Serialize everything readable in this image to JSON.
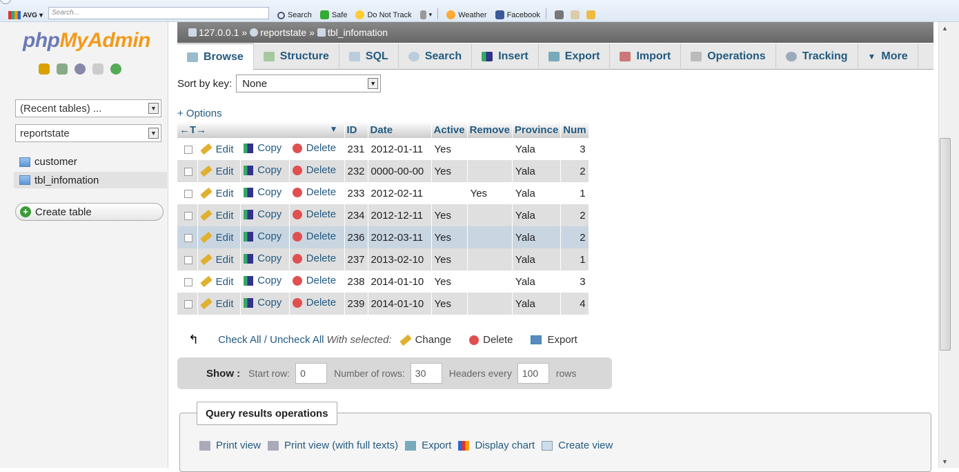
{
  "toolbar": {
    "brand": "AVG",
    "brand_dropdown": "▾",
    "search_placeholder": "Search...",
    "items": [
      "Search",
      "Safe",
      "Do Not Track",
      "Weather",
      "Facebook"
    ]
  },
  "nav": {
    "logo_part1": "php",
    "logo_part2": "MyAdmin",
    "recent_tables": "(Recent tables) ...",
    "database": "reportstate",
    "tables": [
      "customer",
      "tbl_infomation"
    ],
    "create_table": "Create table"
  },
  "breadcrumb": {
    "server": "127.0.0.1",
    "sep1": "»",
    "database": "reportstate",
    "sep2": "»",
    "table": "tbl_infomation"
  },
  "tabs": [
    "Browse",
    "Structure",
    "SQL",
    "Search",
    "Insert",
    "Export",
    "Import",
    "Operations",
    "Tracking",
    "More"
  ],
  "sort": {
    "label": "Sort by key:",
    "value": "None"
  },
  "options_link": "+ Options",
  "table": {
    "header_arrows": "←T→",
    "header_sort_arrow": "▼",
    "columns": [
      "ID",
      "Date",
      "Active",
      "Remove",
      "Province",
      "Num"
    ],
    "action_labels": {
      "edit": "Edit",
      "copy": "Copy",
      "delete": "Delete"
    },
    "rows": [
      {
        "id": "231",
        "date": "2012-01-11",
        "active": "Yes",
        "remove": "",
        "province": "Yala",
        "num": "3"
      },
      {
        "id": "232",
        "date": "0000-00-00",
        "active": "Yes",
        "remove": "",
        "province": "Yala",
        "num": "2"
      },
      {
        "id": "233",
        "date": "2012-02-11",
        "active": "",
        "remove": "Yes",
        "province": "Yala",
        "num": "1"
      },
      {
        "id": "234",
        "date": "2012-12-11",
        "active": "Yes",
        "remove": "",
        "province": "Yala",
        "num": "2"
      },
      {
        "id": "236",
        "date": "2012-03-11",
        "active": "Yes",
        "remove": "",
        "province": "Yala",
        "num": "2"
      },
      {
        "id": "237",
        "date": "2013-02-10",
        "active": "Yes",
        "remove": "",
        "province": "Yala",
        "num": "1"
      },
      {
        "id": "238",
        "date": "2014-01-10",
        "active": "Yes",
        "remove": "",
        "province": "Yala",
        "num": "3"
      },
      {
        "id": "239",
        "date": "2014-01-10",
        "active": "Yes",
        "remove": "",
        "province": "Yala",
        "num": "4"
      }
    ]
  },
  "with_selected": {
    "check_all": "Check All / Uncheck All",
    "label": "With selected:",
    "change": "Change",
    "delete": "Delete",
    "export": "Export"
  },
  "show": {
    "label": "Show :",
    "start_row_label": "Start row:",
    "start_row": "0",
    "num_rows_label": "Number of rows:",
    "num_rows": "30",
    "headers_every_label": "Headers every",
    "headers_every": "100",
    "rows_suffix": "rows"
  },
  "query_ops": {
    "title": "Query results operations",
    "links": [
      "Print view",
      "Print view (with full texts)",
      "Export",
      "Display chart",
      "Create view"
    ]
  },
  "colors": {
    "link": "#235a81",
    "logo_blue": "#6c7ab6",
    "logo_orange": "#f29a1a",
    "highlight_row": "#c9d6e2"
  }
}
